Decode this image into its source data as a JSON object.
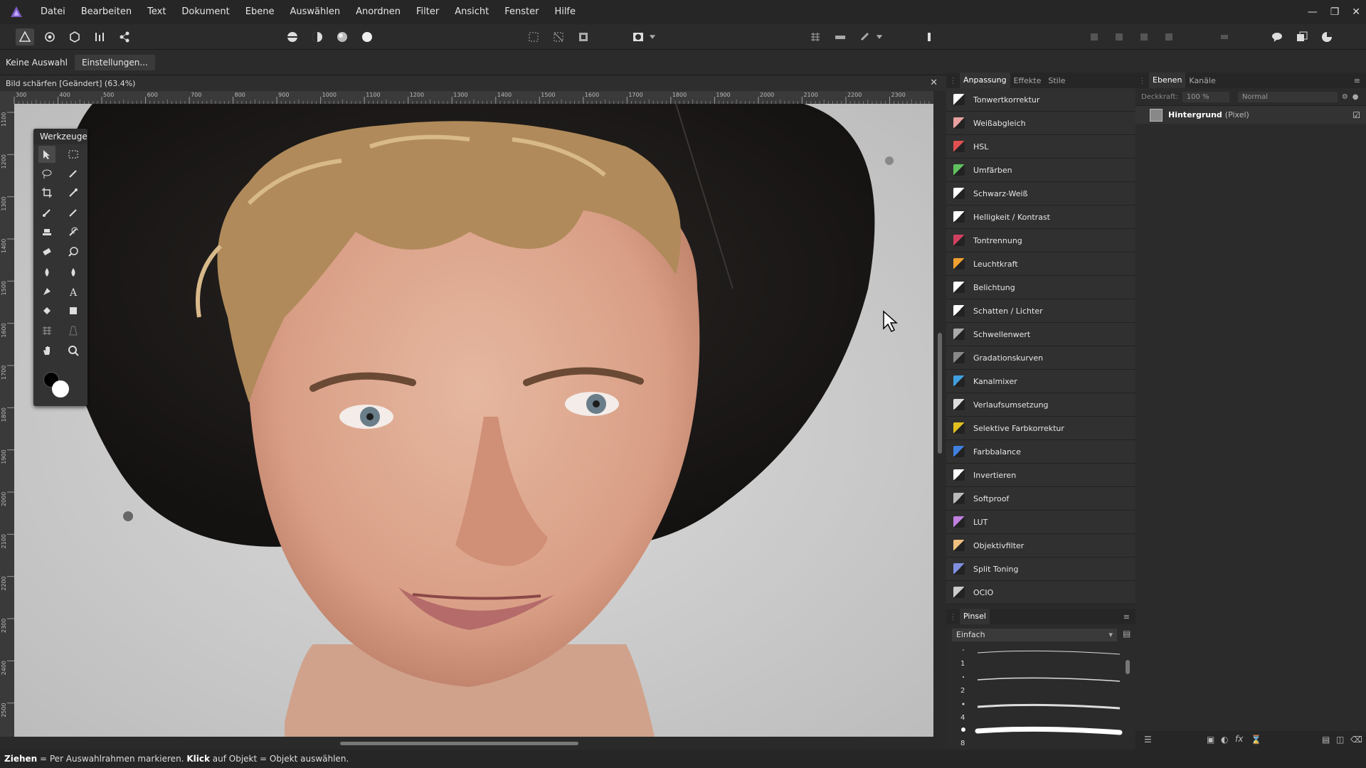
{
  "menu": {
    "items": [
      "Datei",
      "Bearbeiten",
      "Text",
      "Dokument",
      "Ebene",
      "Auswählen",
      "Anordnen",
      "Filter",
      "Ansicht",
      "Fenster",
      "Hilfe"
    ],
    "window_controls": [
      "minimize-icon",
      "restore-icon",
      "close-icon"
    ]
  },
  "toolbar": {
    "persona_icons": [
      "photo-persona-icon",
      "liquify-persona-icon",
      "develop-persona-icon",
      "tone-mapping-persona-icon",
      "export-persona-icon"
    ]
  },
  "context": {
    "selection_label": "Keine Auswahl",
    "settings_button": "Einstellungen..."
  },
  "document": {
    "title": "Bild schärfen [Geändert] (63.4%)",
    "ruler_ticks_x": [
      "300",
      "400",
      "500",
      "600",
      "700",
      "800",
      "900",
      "1000",
      "1100",
      "1200",
      "1300",
      "1400",
      "1500",
      "1600",
      "1700",
      "1800",
      "1900",
      "2000",
      "2100",
      "2200",
      "2300"
    ],
    "ruler_ticks_y": [
      "1100",
      "1200",
      "1300",
      "1400",
      "1500",
      "1600",
      "1700",
      "1800",
      "1900",
      "2000",
      "2100",
      "2200",
      "2300",
      "2400",
      "2500"
    ]
  },
  "tools": {
    "title": "Werkzeuge"
  },
  "adjust_panel": {
    "tabs": [
      "Anpassung",
      "Effekte",
      "Stile"
    ],
    "items": [
      {
        "label": "Tonwertkorrektur",
        "color": "#ffffff"
      },
      {
        "label": "Weißabgleich",
        "color": "#e8a0a0"
      },
      {
        "label": "HSL",
        "color": "#e05050"
      },
      {
        "label": "Umfärben",
        "color": "#60c060"
      },
      {
        "label": "Schwarz-Weiß",
        "color": "#ffffff"
      },
      {
        "label": "Helligkeit / Kontrast",
        "color": "#ffffff"
      },
      {
        "label": "Tontrennung",
        "color": "#d04060"
      },
      {
        "label": "Leuchtkraft",
        "color": "#f0a030"
      },
      {
        "label": "Belichtung",
        "color": "#ffffff"
      },
      {
        "label": "Schatten / Lichter",
        "color": "#ffffff"
      },
      {
        "label": "Schwellenwert",
        "color": "#aaaaaa"
      },
      {
        "label": "Gradationskurven",
        "color": "#888888"
      },
      {
        "label": "Kanalmixer",
        "color": "#40a0e0"
      },
      {
        "label": "Verlaufsumsetzung",
        "color": "#dddddd"
      },
      {
        "label": "Selektive Farbkorrektur",
        "color": "#e0c020"
      },
      {
        "label": "Farbbalance",
        "color": "#4080e0"
      },
      {
        "label": "Invertieren",
        "color": "#ffffff"
      },
      {
        "label": "Softproof",
        "color": "#bbbbbb"
      },
      {
        "label": "LUT",
        "color": "#c080e0"
      },
      {
        "label": "Objektivfilter",
        "color": "#f0c080"
      },
      {
        "label": "Split Toning",
        "color": "#8090e0"
      },
      {
        "label": "OCIO",
        "color": "#cccccc"
      }
    ]
  },
  "brush_panel": {
    "title": "Pinsel",
    "category": "Einfach",
    "sizes": [
      "1",
      "2",
      "4",
      "8"
    ]
  },
  "layers_panel": {
    "tabs": [
      "Ebenen",
      "Kanäle"
    ],
    "opacity_label": "Deckkraft:",
    "opacity": "100 %",
    "blend_mode": "Normal",
    "layer_name": "Hintergrund",
    "layer_type": "(Pixel)"
  },
  "status": {
    "drag_bold": "Ziehen",
    "drag_text": " = Per Auswahlrahmen markieren. ",
    "click_bold": "Klick",
    "click_text": " auf Objekt = Objekt auswählen."
  }
}
